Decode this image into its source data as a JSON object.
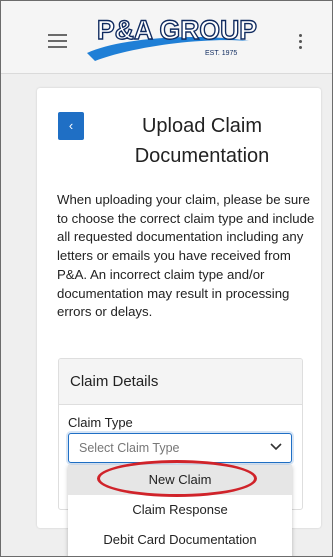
{
  "header": {
    "logo_name": "P&A GROUP",
    "logo_tagline": "EST. 1975",
    "brand_color": "#0f2a5f",
    "swoosh_color": "#1f7fd6"
  },
  "card": {
    "back_symbol": "‹",
    "title_line1": "Upload Claim",
    "title_line2": "Documentation",
    "description": "When uploading your claim, please be sure to choose the correct claim type and include all requested documentation including any letters or emails you have received from P&A. An incorrect claim type and/or documentation may result in processing errors or delays."
  },
  "claim_details": {
    "heading": "Claim Details",
    "claim_type_label": "Claim Type",
    "select_placeholder": "Select Claim Type",
    "options": [
      "New Claim",
      "Claim Response",
      "Debit Card Documentation"
    ],
    "highlighted_option": "New Claim"
  },
  "colors": {
    "accent": "#1f6fc5",
    "annotation_ring": "#d0232a"
  }
}
